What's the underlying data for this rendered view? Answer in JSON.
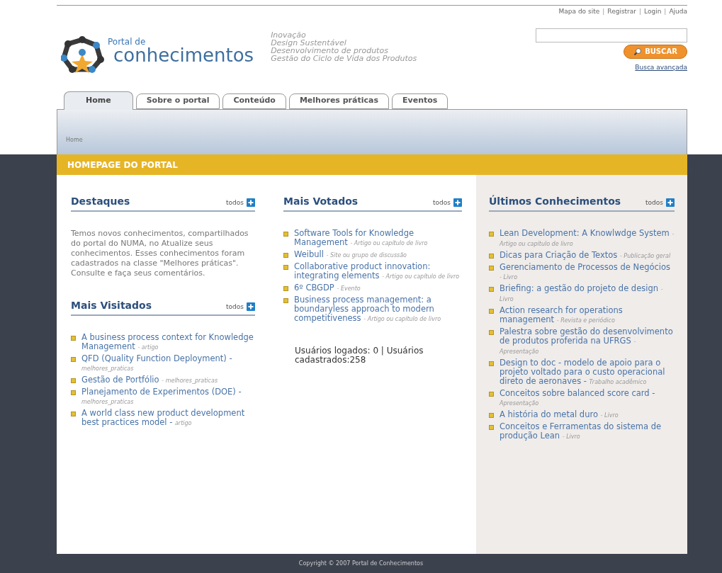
{
  "top_links": [
    {
      "kind": "link",
      "text": "Mapa do site"
    },
    {
      "kind": "separator",
      "text": "|"
    },
    {
      "kind": "link",
      "text": "Registrar"
    },
    {
      "kind": "separator",
      "text": "|"
    },
    {
      "kind": "link",
      "text": "Login"
    },
    {
      "kind": "separator",
      "text": "|"
    },
    {
      "kind": "link",
      "text": "Ajuda"
    }
  ],
  "logo": {
    "small": "Portal de",
    "big": "conhecimentos"
  },
  "taglines": [
    "Inovação",
    "Design Sustentável",
    "Desenvolvimento de produtos",
    "Gestão do Ciclo de Vida dos Produtos"
  ],
  "search": {
    "button": "BUSCAR",
    "advanced": "Busca avançada"
  },
  "tabs": [
    {
      "label": "Home",
      "selected": true
    },
    {
      "label": "Sobre o portal",
      "selected": false
    },
    {
      "label": "Conteúdo",
      "selected": false
    },
    {
      "label": "Melhores práticas",
      "selected": false
    },
    {
      "label": "Eventos",
      "selected": false
    }
  ],
  "breadcrumb": "Home",
  "page_title": "HOMEPAGE DO PORTAL",
  "columns": [
    {
      "shaded": false,
      "sections": [
        {
          "title": "Destaques",
          "more": "todos",
          "text": "Temos novos conhecimentos, compartilhados do portal do NUMA, no Atualize seus conhecimentos. Esses conhecimentos foram cadastrados na classe \"Melhores práticas\". Consulte e faça seus comentários."
        },
        {
          "title": "Mais Visitados",
          "more": "todos",
          "items": [
            {
              "title": "A business process context for Knowledge Management",
              "type": "- artigo"
            },
            {
              "title": "QFD (Quality Function Deployment) -",
              "type": "melhores_praticas"
            },
            {
              "title": "Gestão de Portfólio",
              "type": "- melhores_praticas"
            },
            {
              "title": "Planejamento de Experimentos (DOE) -",
              "type": "melhores_praticas"
            },
            {
              "title": "A world class new product development best practices model -",
              "type": "artigo"
            }
          ]
        }
      ]
    },
    {
      "shaded": false,
      "sections": [
        {
          "title": "Mais Votados",
          "more": "todos",
          "items": [
            {
              "title": "Software Tools for Knowledge Management",
              "type": "- Artigo ou capítulo de livro"
            },
            {
              "title": "Weibull",
              "type": "- Site ou grupo de discussão"
            },
            {
              "title": "Collaborative product innovation: integrating elements",
              "type": "- Artigo ou capítulo de livro"
            },
            {
              "title": "6º CBGDP",
              "type": "- Evento"
            },
            {
              "title": "Business process management: a boundaryless approach to modern competitiveness",
              "type": "- Artigo ou capítulo de livro"
            }
          ],
          "stats": "Usuários logados: 0 | Usuários cadastrados:258"
        }
      ]
    },
    {
      "shaded": true,
      "sections": [
        {
          "title": "Últimos Conhecimentos",
          "more": "todos",
          "items": [
            {
              "title": "Lean Development: A Knowlwdge System",
              "type": "- Artigo ou capítulo de livro"
            },
            {
              "title": "Dicas para Criação de Textos",
              "type": "- Publicação geral"
            },
            {
              "title": "Gerenciamento de Processos de Negócios",
              "type": "- Livro"
            },
            {
              "title": "Briefing: a gestão do projeto de design",
              "type": "- Livro"
            },
            {
              "title": "Action research for operations management",
              "type": "- Revista e periódico"
            },
            {
              "title": "Palestra sobre gestão do desenvolvimento de produtos proferida na UFRGS",
              "type": "- Apresentação"
            },
            {
              "title": "Design to doc - modelo de apoio para o projeto voltado para o custo operacional direto de aeronaves -",
              "type": "Trabalho acadêmico"
            },
            {
              "title": "Conceitos sobre balanced score card -",
              "type": "Apresentação"
            },
            {
              "title": "A história do metal duro",
              "type": "- Livro"
            },
            {
              "title": "Conceitos e Ferramentas do sistema de produção Lean",
              "type": "- Livro"
            }
          ]
        }
      ]
    }
  ],
  "footer": "Copyright © 2007 Portal de Conhecimentos"
}
